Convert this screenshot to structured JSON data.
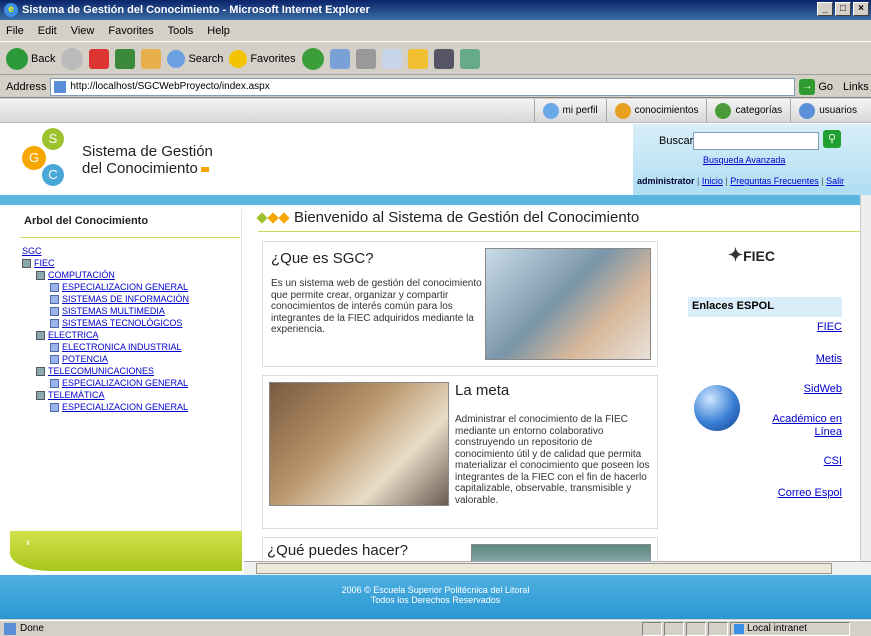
{
  "window": {
    "title": "Sistema de Gestión del Conocimiento - Microsoft Internet Explorer",
    "btn_min": "_",
    "btn_max": "□",
    "btn_close": "×"
  },
  "menu": [
    "File",
    "Edit",
    "View",
    "Favorites",
    "Tools",
    "Help"
  ],
  "toolbar": {
    "back": "Back",
    "search": "Search",
    "favorites": "Favorites"
  },
  "address": {
    "label": "Address",
    "url": "http://localhost/SGCWebProyecto/index.aspx",
    "go": "Go",
    "links": "Links"
  },
  "topnav": [
    {
      "label": "mi perfil",
      "icon": "user-icon"
    },
    {
      "label": "conocimientos",
      "icon": "knowledge-icon"
    },
    {
      "label": "categorías",
      "icon": "categories-icon"
    },
    {
      "label": "usuarios",
      "icon": "users-icon"
    }
  ],
  "site": {
    "logo_letters": [
      "S",
      "G",
      "C"
    ],
    "title_line1": "Sistema de Gestión",
    "title_line2": "del Conocimiento"
  },
  "search": {
    "label": "Buscar",
    "advanced": "Busqueda Avanzada",
    "user": "administrator",
    "links": [
      "Inicio",
      "Preguntas Frecuentes",
      "Salir"
    ]
  },
  "tree": {
    "title": "Arbol del Conocimiento",
    "root": "SGC",
    "nodes": [
      {
        "label": "FIEC",
        "level": 0,
        "type": "book"
      },
      {
        "label": "COMPUTACIÓN",
        "level": 1,
        "type": "book"
      },
      {
        "label": "ESPECIALIZACION GENERAL",
        "level": 2,
        "type": "doc"
      },
      {
        "label": "SISTEMAS DE INFORMACIÓN",
        "level": 2,
        "type": "doc"
      },
      {
        "label": "SISTEMAS MULTIMEDIA",
        "level": 2,
        "type": "doc"
      },
      {
        "label": "SISTEMAS TECNOLÓGICOS",
        "level": 2,
        "type": "doc"
      },
      {
        "label": "ELECTRICA",
        "level": 1,
        "type": "book"
      },
      {
        "label": "ELECTRONICA INDUSTRIAL",
        "level": 2,
        "type": "doc"
      },
      {
        "label": "POTENCIA",
        "level": 2,
        "type": "doc"
      },
      {
        "label": "TELECOMUNICACIONES",
        "level": 1,
        "type": "book"
      },
      {
        "label": "ESPECIALIZACION GENERAL",
        "level": 2,
        "type": "doc"
      },
      {
        "label": "TELEMÁTICA",
        "level": 1,
        "type": "book"
      },
      {
        "label": "ESPECIALIZACION GENERAL",
        "level": 2,
        "type": "doc"
      }
    ]
  },
  "main": {
    "welcome": "Bienvenido al Sistema de Gestión del Conocimiento",
    "box1_title": "¿Que es SGC?",
    "box1_text": "Es un sistema web de gestión del conocimiento que permite crear, organizar y compartir conocimientos de interés común para los integrantes de la FIEC adquiridos mediante la experiencia.",
    "box2_title": "La meta",
    "box2_text": "Administrar el conocimiento de la FIEC mediante un entorno colaborativo construyendo un repositorio de conocimiento útil y de calidad que permita materializar el conocimiento que poseen los integrantes de la FIEC con el fin de hacerlo capitalizable, observable, transmisible y valorable.",
    "box3_title": "¿Qué puedes hacer?"
  },
  "sidebar_right": {
    "fiec_logo": "FIEC",
    "links_title": "Enlaces ESPOL",
    "links": [
      "FIEC",
      "Metis",
      "SidWeb",
      "Académico en Línea",
      "CSI",
      "Correo Espol"
    ]
  },
  "footer": {
    "line1": "2006 © Escuela Superior Politécnica del Litoral",
    "line2": "Todos los Derechos Reservados"
  },
  "status": {
    "left": "Done",
    "zone": "Local intranet"
  },
  "colors": {
    "accent_blue": "#5ab5df",
    "accent_green": "#b5d02c",
    "orange": "#f7a600"
  }
}
